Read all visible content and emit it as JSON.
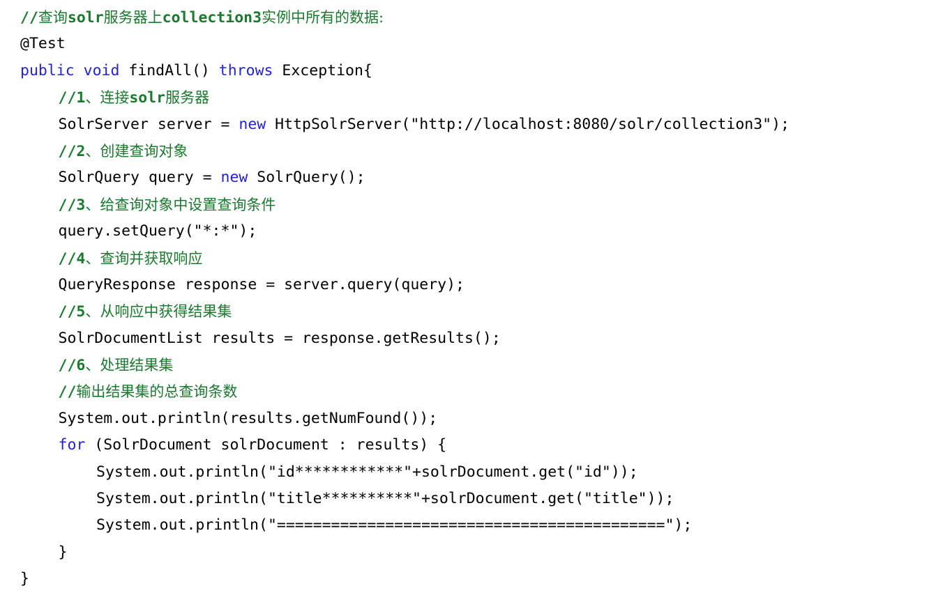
{
  "document": {
    "kind": "source-code-snippet",
    "language": "Java",
    "background_color": "#ffffff",
    "colors": {
      "keyword": "#2222e0",
      "comment": "#1a7a2e",
      "text": "#000000"
    }
  },
  "code": {
    "lines": [
      {
        "indent": 0,
        "type": "comment",
        "tokens": [
          {
            "cls": "cmt lat",
            "text": "//"
          },
          {
            "cls": "cmt cjk",
            "text": "查询"
          },
          {
            "cls": "cmt lat",
            "text": "solr"
          },
          {
            "cls": "cmt cjk",
            "text": "服务器上"
          },
          {
            "cls": "cmt lat",
            "text": "collection3"
          },
          {
            "cls": "cmt cjk",
            "text": "实例中所有的数据:"
          }
        ]
      },
      {
        "indent": 0,
        "type": "annotation",
        "tokens": [
          {
            "cls": "plain",
            "text": "@Test"
          }
        ]
      },
      {
        "indent": 0,
        "type": "code",
        "tokens": [
          {
            "cls": "kw",
            "text": "public"
          },
          {
            "cls": "plain",
            "text": " "
          },
          {
            "cls": "kw",
            "text": "void"
          },
          {
            "cls": "plain",
            "text": " findAll() "
          },
          {
            "cls": "kw",
            "text": "throws"
          },
          {
            "cls": "plain",
            "text": " Exception{"
          }
        ]
      },
      {
        "indent": 1,
        "type": "comment",
        "tokens": [
          {
            "cls": "cmt lat",
            "text": "//1"
          },
          {
            "cls": "cmt cjk",
            "text": "、连接"
          },
          {
            "cls": "cmt lat",
            "text": "solr"
          },
          {
            "cls": "cmt cjk",
            "text": "服务器"
          }
        ]
      },
      {
        "indent": 1,
        "type": "code",
        "tokens": [
          {
            "cls": "plain",
            "text": "SolrServer server = "
          },
          {
            "cls": "kw",
            "text": "new"
          },
          {
            "cls": "plain",
            "text": " HttpSolrServer(\"http://localhost:8080/solr/collection3\");"
          }
        ]
      },
      {
        "indent": 1,
        "type": "comment",
        "tokens": [
          {
            "cls": "cmt lat",
            "text": "//2"
          },
          {
            "cls": "cmt cjk",
            "text": "、创建查询对象"
          }
        ]
      },
      {
        "indent": 1,
        "type": "code",
        "tokens": [
          {
            "cls": "plain",
            "text": "SolrQuery query = "
          },
          {
            "cls": "kw",
            "text": "new"
          },
          {
            "cls": "plain",
            "text": " SolrQuery();"
          }
        ]
      },
      {
        "indent": 1,
        "type": "comment",
        "tokens": [
          {
            "cls": "cmt lat",
            "text": "//3"
          },
          {
            "cls": "cmt cjk",
            "text": "、给查询对象中设置查询条件"
          }
        ]
      },
      {
        "indent": 1,
        "type": "code",
        "tokens": [
          {
            "cls": "plain",
            "text": "query.setQuery(\"*:*\");"
          }
        ]
      },
      {
        "indent": 1,
        "type": "comment",
        "tokens": [
          {
            "cls": "cmt lat",
            "text": "//4"
          },
          {
            "cls": "cmt cjk",
            "text": "、查询并获取响应"
          }
        ]
      },
      {
        "indent": 1,
        "type": "code",
        "tokens": [
          {
            "cls": "plain",
            "text": "QueryResponse response = server.query(query);"
          }
        ]
      },
      {
        "indent": 1,
        "type": "comment",
        "tokens": [
          {
            "cls": "cmt lat",
            "text": "//5"
          },
          {
            "cls": "cmt cjk",
            "text": "、从响应中获得结果集"
          }
        ]
      },
      {
        "indent": 1,
        "type": "code",
        "tokens": [
          {
            "cls": "plain",
            "text": "SolrDocumentList results = response.getResults();"
          }
        ]
      },
      {
        "indent": 1,
        "type": "comment",
        "tokens": [
          {
            "cls": "cmt lat",
            "text": "//6"
          },
          {
            "cls": "cmt cjk",
            "text": "、处理结果集"
          }
        ]
      },
      {
        "indent": 1,
        "type": "comment",
        "tokens": [
          {
            "cls": "cmt lat",
            "text": "//"
          },
          {
            "cls": "cmt cjk",
            "text": "输出结果集的总查询条数"
          }
        ]
      },
      {
        "indent": 1,
        "type": "code",
        "tokens": [
          {
            "cls": "plain",
            "text": "System.out.println(results.getNumFound());"
          }
        ]
      },
      {
        "indent": 1,
        "type": "code",
        "tokens": [
          {
            "cls": "kw",
            "text": "for"
          },
          {
            "cls": "plain",
            "text": " (SolrDocument solrDocument : results) {"
          }
        ]
      },
      {
        "indent": 2,
        "type": "code",
        "tokens": [
          {
            "cls": "plain",
            "text": "System.out.println(\"id************\"+solrDocument.get(\"id\"));"
          }
        ]
      },
      {
        "indent": 2,
        "type": "code",
        "tokens": [
          {
            "cls": "plain",
            "text": "System.out.println(\"title**********\"+solrDocument.get(\"title\"));"
          }
        ]
      },
      {
        "indent": 2,
        "type": "code",
        "tokens": [
          {
            "cls": "plain",
            "text": "System.out.println(\"===========================================\");"
          }
        ]
      },
      {
        "indent": 1,
        "type": "code",
        "tokens": [
          {
            "cls": "plain",
            "text": "}"
          }
        ]
      },
      {
        "indent": 0,
        "type": "code",
        "tokens": [
          {
            "cls": "plain",
            "text": "}"
          }
        ]
      }
    ]
  }
}
